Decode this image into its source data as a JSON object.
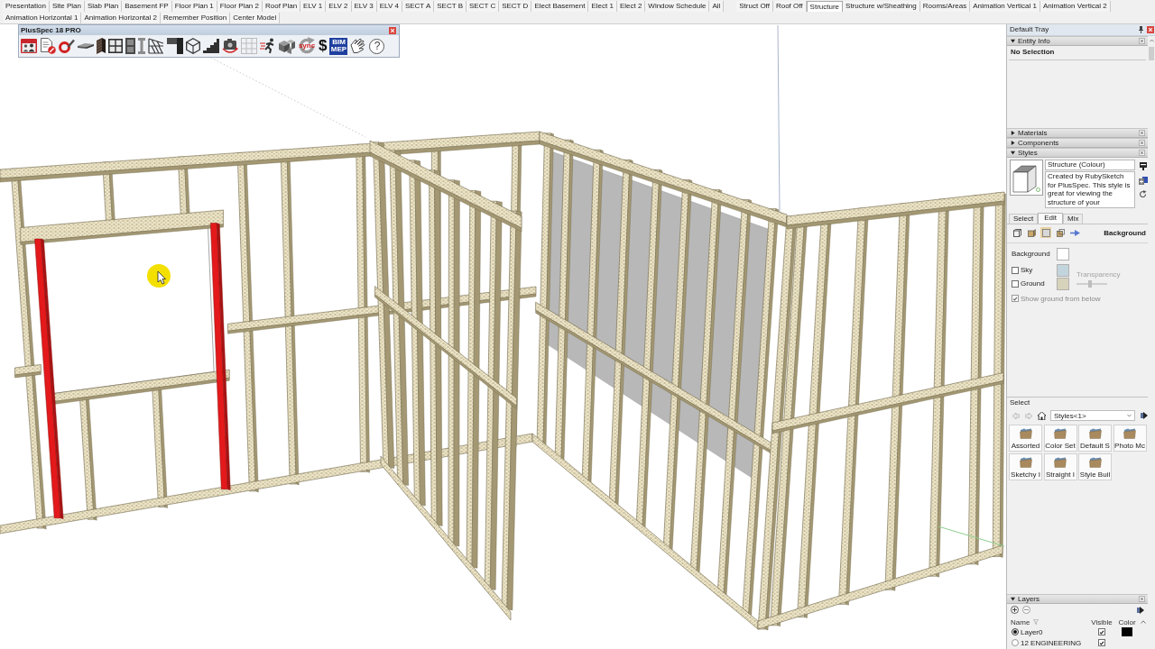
{
  "scene_tab_groups": [
    {
      "tabs": [
        {
          "label": "Presentation",
          "selected": false
        },
        {
          "label": "Site Plan",
          "selected": false
        },
        {
          "label": "Slab Plan",
          "selected": false
        },
        {
          "label": "Basement FP",
          "selected": false
        },
        {
          "label": "Floor Plan 1",
          "selected": false
        },
        {
          "label": "Floor Plan 2",
          "selected": false
        },
        {
          "label": "Roof Plan",
          "selected": false
        },
        {
          "label": "ELV 1",
          "selected": false
        },
        {
          "label": "ELV 2",
          "selected": false
        },
        {
          "label": "ELV 3",
          "selected": false
        },
        {
          "label": "ELV 4",
          "selected": false
        },
        {
          "label": "SECT A",
          "selected": false
        },
        {
          "label": "SECT B",
          "selected": false
        },
        {
          "label": "SECT C",
          "selected": false
        },
        {
          "label": "SECT D",
          "selected": false
        },
        {
          "label": "Elect Basement",
          "selected": false
        },
        {
          "label": "Elect 1",
          "selected": false
        },
        {
          "label": "Elect 2",
          "selected": false
        },
        {
          "label": "Window Schedule",
          "selected": false
        },
        {
          "label": "All",
          "selected": false
        }
      ]
    },
    {
      "tabs": [
        {
          "label": "Struct Off",
          "selected": false
        },
        {
          "label": "Roof Off",
          "selected": false
        },
        {
          "label": "Structure",
          "selected": true
        },
        {
          "label": "Structure w/Sheathing",
          "selected": false
        },
        {
          "label": "Rooms/Areas",
          "selected": false
        },
        {
          "label": "Animation Vertical 1",
          "selected": false
        },
        {
          "label": "Animation Vertical 2",
          "selected": false
        },
        {
          "label": "Animation Horizontal 1",
          "selected": false
        },
        {
          "label": "Animation Horizontal 2",
          "selected": false
        },
        {
          "label": "Remember Position",
          "selected": false
        },
        {
          "label": "Center Model",
          "selected": false
        }
      ]
    }
  ],
  "toolbar": {
    "title": "PlusSpec 18 PRO",
    "sync_label": "sync",
    "cost_label": "$",
    "bim_label": [
      "BIM",
      "MEP"
    ],
    "help_label": "?"
  },
  "tray": {
    "title": "Default Tray",
    "entity_info": {
      "title": "Entity Info",
      "expanded": true,
      "selection": "No Selection"
    },
    "materials": {
      "title": "Materials",
      "expanded": false
    },
    "components": {
      "title": "Components",
      "expanded": false
    },
    "styles": {
      "title": "Styles",
      "expanded": true,
      "style_name": "Structure (Colour)",
      "description": "Created by RubySketch for PlusSpec. This style is great for viewing the structure of your",
      "tabs": [
        {
          "label": "Select",
          "selected": false
        },
        {
          "label": "Edit",
          "selected": true
        },
        {
          "label": "Mix",
          "selected": false
        }
      ],
      "edit_buttons": [
        {
          "selected": false
        },
        {
          "selected": false
        },
        {
          "selected": true
        },
        {
          "selected": false
        },
        {
          "selected": false
        }
      ],
      "section_title": "Background",
      "settings": [
        {
          "kind": "swatch",
          "label": "Background",
          "color": "#ffffff"
        },
        {
          "kind": "checkbox",
          "label": "Sky",
          "checked": false,
          "color": "#c3d5dc"
        },
        {
          "kind": "checkbox",
          "label": "Ground",
          "checked": false,
          "color": "#d7d3ba"
        }
      ],
      "transparency": {
        "label": "Transparency",
        "disabled": true,
        "level": 0.45
      },
      "show_ground": {
        "label": "Show ground from below",
        "checked": true,
        "disabled": true
      },
      "browser": {
        "title": "Select",
        "collection": "Styles<1>",
        "folders": [
          {
            "label": "Assorted"
          },
          {
            "label": "Color Set"
          },
          {
            "label": "Default S"
          },
          {
            "label": "Photo Mc"
          },
          {
            "label": "Sketchy I"
          },
          {
            "label": "Straight I"
          },
          {
            "label": "Style Buil"
          }
        ]
      }
    },
    "layers": {
      "title": "Layers",
      "expanded": true,
      "columns": [
        "Name",
        "Visible",
        "Color"
      ],
      "rows": [
        {
          "name": "Layer0",
          "selected": true,
          "visible": true,
          "color": "#000000"
        },
        {
          "name": "12 ENGINEERING",
          "selected": false,
          "visible": true
        }
      ]
    }
  }
}
